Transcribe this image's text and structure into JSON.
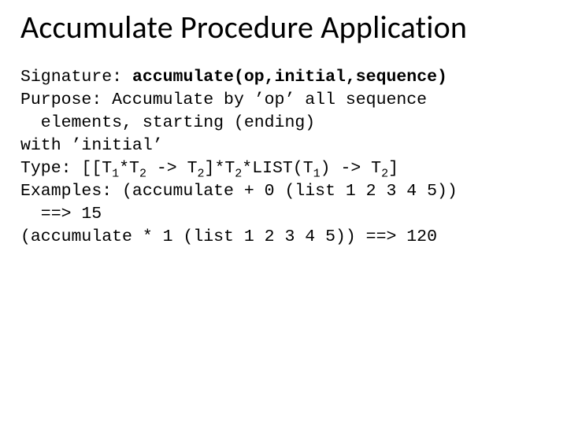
{
  "title": "Accumulate Procedure Application",
  "sig_label": "Signature: ",
  "sig_value": "accumulate(op,initial,sequence)",
  "purpose_line1": "Purpose: Accumulate by ’op’ all sequence",
  "purpose_line2": "elements, starting (ending)",
  "purpose_line3": "with ’initial’",
  "type_prefix": "Type: [[T",
  "t_star": "*T",
  "arrow_t": " -> T",
  "bracket_star_t": "]*T",
  "list_t": "*LIST(T",
  "close_arrow_t": ") -> T",
  "close_bracket": "]",
  "sub1": "1",
  "sub2": "2",
  "examples_line1": "Examples: (accumulate + 0 (list 1 2 3 4 5))",
  "examples_line2": "==> 15",
  "examples_line3": "(accumulate * 1 (list 1 2 3 4 5)) ==> 120"
}
